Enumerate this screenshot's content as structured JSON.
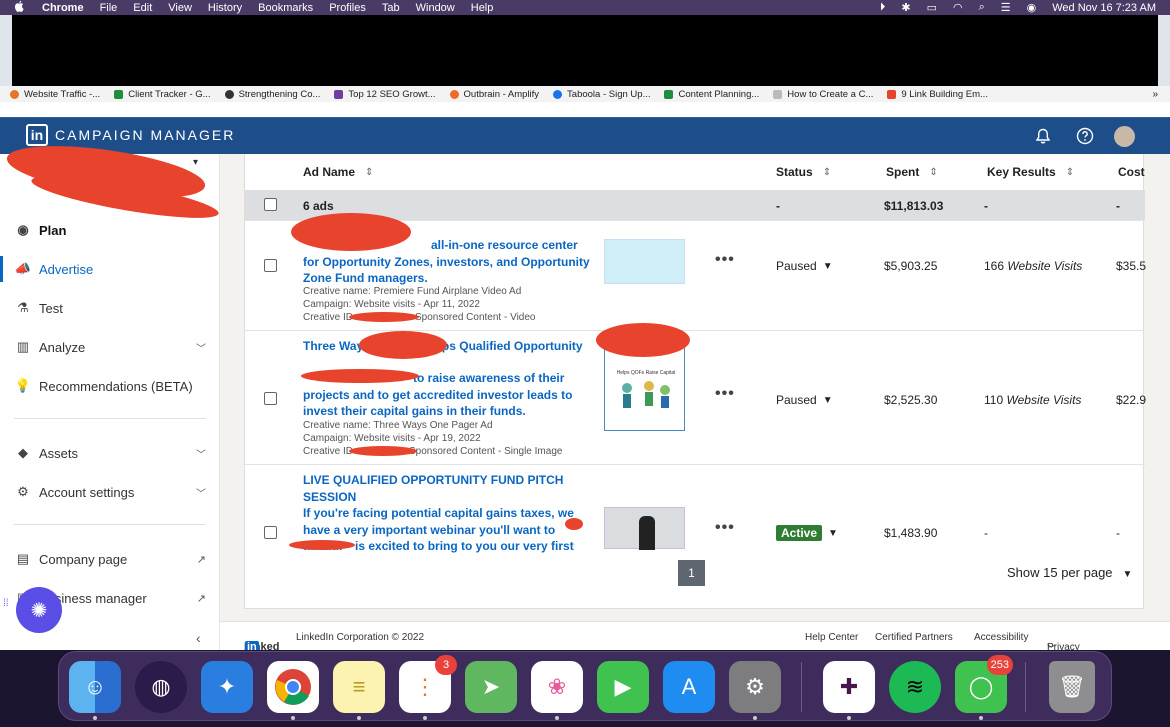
{
  "menubar": {
    "app": "Chrome",
    "items": [
      "File",
      "Edit",
      "View",
      "History",
      "Bookmarks",
      "Profiles",
      "Tab",
      "Window",
      "Help"
    ],
    "datetime": "Wed Nov 16  7:23 AM"
  },
  "bookmarks": [
    {
      "label": "Website Traffic -...",
      "color": "#e8742c"
    },
    {
      "label": "Client Tracker - G...",
      "color": "#1e8e3e"
    },
    {
      "label": "Strengthening Co...",
      "color": "#333333"
    },
    {
      "label": "Top 12 SEO Growt...",
      "color": "#6b3fa0"
    },
    {
      "label": "Outbrain - Amplify",
      "color": "#f06a2a"
    },
    {
      "label": "Taboola - Sign Up...",
      "color": "#1a73e8"
    },
    {
      "label": "Content Planning...",
      "color": "#1e8e3e"
    },
    {
      "label": "How to Create a C...",
      "color": "#999999"
    },
    {
      "label": "9 Link Building Em...",
      "color": "#e8432c"
    }
  ],
  "bookmarks_more": "»",
  "header": {
    "logo": "in",
    "brand": "CAMPAIGN MANAGER"
  },
  "sidebar": {
    "items": [
      {
        "label": "Plan"
      },
      {
        "label": "Advertise"
      },
      {
        "label": "Test"
      },
      {
        "label": "Analyze"
      },
      {
        "label": "Recommendations (BETA)"
      },
      {
        "label": "Assets"
      },
      {
        "label": "Account settings"
      },
      {
        "label": "Company page"
      },
      {
        "label": "Business manager"
      }
    ]
  },
  "table": {
    "headers": {
      "ad_name": "Ad Name",
      "status": "Status",
      "spent": "Spent",
      "key_results": "Key Results",
      "cost": "Cost"
    },
    "summary": {
      "label": "6 ads",
      "status": "-",
      "spent": "$11,813.03",
      "key_results": "-",
      "cost": "-"
    },
    "rows": [
      {
        "title": "all-in-one resource center for Opportunity Zones, investors, and Opportunity Zone Fund managers.",
        "creative": "Creative name: Premiere Fund Airplane Video Ad",
        "campaign": "Campaign: Website visits - Apr 11, 2022",
        "creative_id": "Creative ID",
        "format": "Sponsored Content - Video",
        "status": "Paused",
        "spent": "$5,903.25",
        "kr_num": "166",
        "kr_label": "Website Visits",
        "cost": "$35.5"
      },
      {
        "title_line1": "Three Way",
        "title_line1b": "Helps Qualified Opportunity",
        "title_rest": "to raise awareness of their projects and to get accredited investor leads to invest their capital gains in their funds.",
        "creative": "Creative name: Three Ways One Pager Ad",
        "campaign": "Campaign: Website visits - Apr 19, 2022",
        "creative_id": "Creative ID",
        "format": "Sponsored Content - Single Image",
        "thumb_caption": "Helps QOFs Raise Capital",
        "status": "Paused",
        "spent": "$2,525.30",
        "kr_num": "110",
        "kr_label": "Website Visits",
        "cost": "$22.9"
      },
      {
        "title": "LIVE QUALIFIED OPPORTUNITY FUND PITCH SESSION",
        "body": "If you're facing potential capital gains taxes, we have a very important webinar you'll want to attend.",
        "body2": "is excited to bring to you our very first",
        "status": "Active",
        "spent": "$1,483.90",
        "kr": "-",
        "cost": "-"
      }
    ],
    "page": "1",
    "per_page": "Show 15 per page"
  },
  "footer": {
    "brand": "Linked",
    "brand_in": "in",
    "copyright": "LinkedIn Corporation © 2022",
    "links": [
      "Help Center",
      "Certified Partners",
      "Accessibility",
      "Privacy & Terms"
    ]
  },
  "dock": {
    "apps": [
      {
        "name": "Finder",
        "color": "#3a8ee6"
      },
      {
        "name": "Siri",
        "color": "#2b1b4a"
      },
      {
        "name": "Safari",
        "color": "#2a7ee0"
      },
      {
        "name": "Chrome",
        "color": "#ffffff"
      },
      {
        "name": "Notes",
        "color": "#fdf3b0"
      },
      {
        "name": "Reminders",
        "color": "#ffffff",
        "badge": "3"
      },
      {
        "name": "Maps",
        "color": "#5fb860"
      },
      {
        "name": "Photos",
        "color": "#ffffff"
      },
      {
        "name": "FaceTime",
        "color": "#3fc24f"
      },
      {
        "name": "App Store",
        "color": "#1e8cf0"
      },
      {
        "name": "System Preferences",
        "color": "#7d7d80"
      },
      {
        "name": "Slack",
        "color": "#ffffff"
      },
      {
        "name": "Spotify",
        "color": "#1db954"
      },
      {
        "name": "Messages",
        "color": "#3fc24f",
        "badge": "253"
      },
      {
        "name": "Trash",
        "color": "#8e8e90"
      }
    ]
  }
}
